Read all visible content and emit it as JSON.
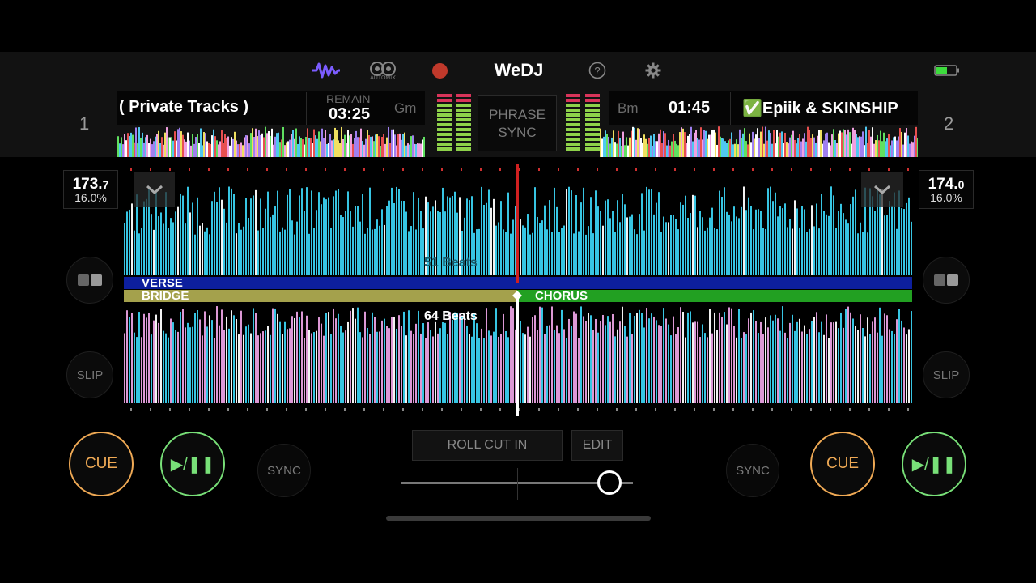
{
  "app": {
    "title": "WeDJ",
    "automix_label": "AUTOMIX"
  },
  "toolbar": {
    "icons": [
      "waveform-icon",
      "automix-icon",
      "record-icon",
      "help-icon",
      "gear-icon",
      "battery-icon"
    ],
    "accent_waveform": "#7b5cff",
    "record_color": "#c0392b",
    "battery_color": "#3ddc3d"
  },
  "deck1": {
    "number": "1",
    "title": "( Private Tracks )",
    "time_label": "REMAIN",
    "time": "03:25",
    "key": "Gm",
    "bpm_main": "173.",
    "bpm_dec": "7",
    "pitch": "16.0%",
    "slip": "SLIP",
    "cue": "CUE",
    "play": "▶/❚❚",
    "sync": "SYNC"
  },
  "deck2": {
    "number": "2",
    "title": "✅Epiik & SKINSHIP",
    "time": "01:45",
    "key": "Bm",
    "bpm_main": "174.",
    "bpm_dec": "0",
    "pitch": "16.0%",
    "slip": "SLIP",
    "cue": "CUE",
    "play": "▶/❚❚",
    "sync": "SYNC"
  },
  "center": {
    "phrase_sync_line1": "PHRASE",
    "phrase_sync_line2": "SYNC",
    "roll_cut_in": "ROLL CUT IN",
    "edit": "EDIT",
    "crossfader_position": 0.9
  },
  "waveform": {
    "top_beats": "51 Beats",
    "bottom_beats": "64 Beats",
    "phrase_top": "VERSE",
    "phrase_bottom_left": "BRIDGE",
    "phrase_bottom_right": "CHORUS",
    "top_color": "#3ad0ef",
    "bottom_color_a": "#e8a0e0",
    "bottom_color_b": "#3ad0ef",
    "verse_color": "#0d1f9e",
    "bridge_color": "#a4a14c",
    "chorus_color": "#22a022"
  }
}
